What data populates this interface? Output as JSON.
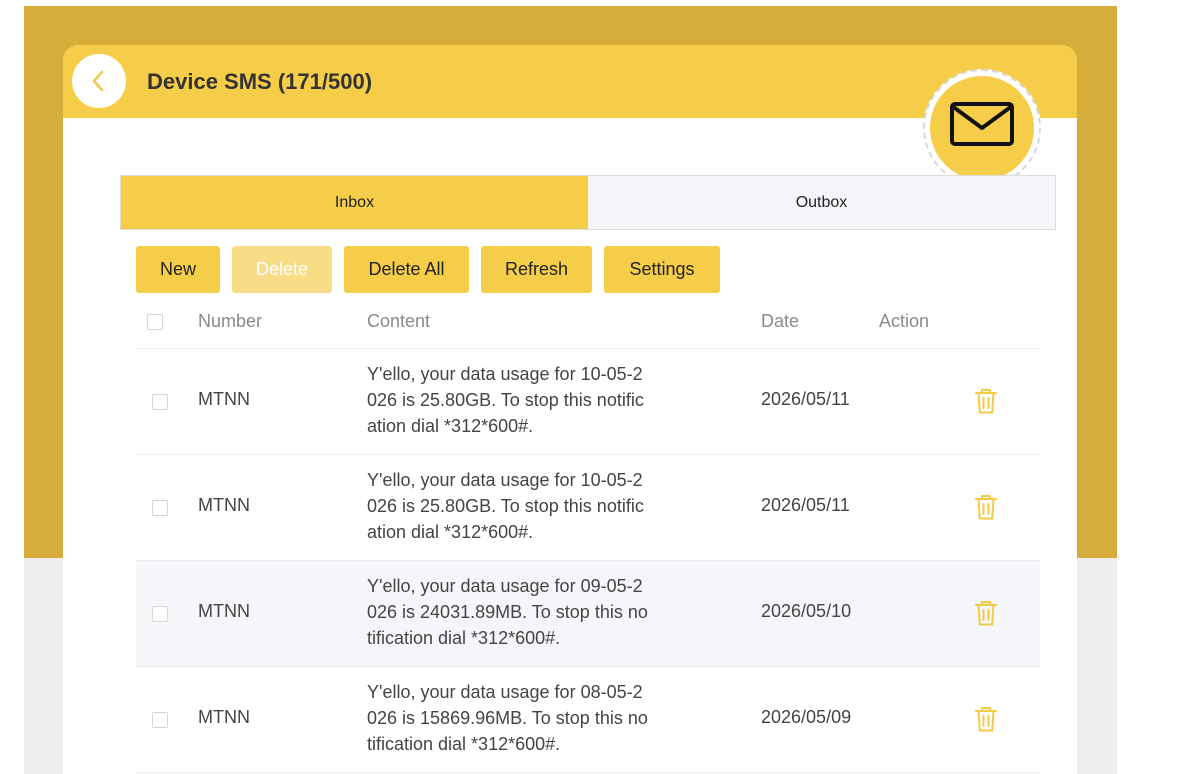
{
  "header": {
    "title": "Device SMS (171/500)",
    "back_icon": "chevron-left-icon",
    "badge_icon": "envelope-icon"
  },
  "tabs": [
    {
      "label": "Inbox",
      "active": true
    },
    {
      "label": "Outbox",
      "active": false
    }
  ],
  "toolbar": {
    "new_label": "New",
    "delete_label": "Delete",
    "delete_all_label": "Delete All",
    "refresh_label": "Refresh",
    "settings_label": "Settings"
  },
  "table": {
    "columns": {
      "number": "Number",
      "content": "Content",
      "date": "Date",
      "action": "Action"
    },
    "rows": [
      {
        "number": "MTNN",
        "content": "Y'ello, your data usage for 10-05-2\n026 is 25.80GB. To stop this notific\nation dial *312*600#.",
        "date": "2026/05/11"
      },
      {
        "number": "MTNN",
        "content": "Y'ello, your data usage for 10-05-2\n026 is 25.80GB. To stop this notific\nation dial *312*600#.",
        "date": "2026/05/11"
      },
      {
        "number": "MTNN",
        "content": "Y'ello, your data usage for 09-05-2\n026 is 24031.89MB. To stop this no\ntification dial *312*600#.",
        "date": "2026/05/10"
      },
      {
        "number": "MTNN",
        "content": "Y'ello, your data usage for 08-05-2\n026 is 15869.96MB. To stop this no\ntification dial *312*600#.",
        "date": "2026/05/09"
      }
    ]
  },
  "colors": {
    "accent": "#f6cd48",
    "background_gold": "#d6ad3b",
    "icon_yellow": "#f3c945"
  }
}
